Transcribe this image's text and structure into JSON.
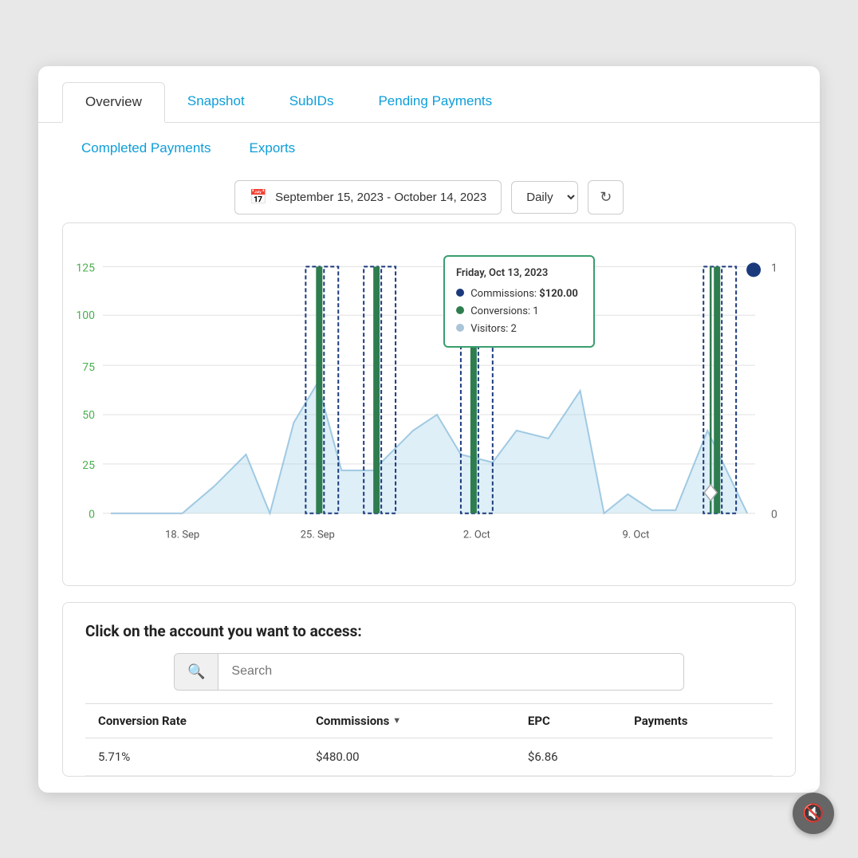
{
  "tabs_row1": [
    {
      "id": "overview",
      "label": "Overview",
      "active": true
    },
    {
      "id": "snapshot",
      "label": "Snapshot",
      "active": false
    },
    {
      "id": "subids",
      "label": "SubIDs",
      "active": false
    },
    {
      "id": "pending",
      "label": "Pending Payments",
      "active": false
    }
  ],
  "tabs_row2": [
    {
      "id": "completed",
      "label": "Completed Payments"
    },
    {
      "id": "exports",
      "label": "Exports"
    }
  ],
  "date_range": {
    "label": "September 15, 2023 - October 14, 2023",
    "interval": "Daily",
    "refresh_label": "↻"
  },
  "chart": {
    "y_labels": [
      "125",
      "100",
      "75",
      "50",
      "25",
      "0"
    ],
    "x_labels": [
      "18. Sep",
      "25. Sep",
      "2. Oct",
      "9. Oct"
    ],
    "right_labels": [
      "1",
      "0"
    ],
    "tooltip": {
      "title": "Friday, Oct 13, 2023",
      "commissions_label": "Commissions: ",
      "commissions_value": "$120.00",
      "conversions_label": "Conversions: 1",
      "visitors_label": "Visitors: 2"
    }
  },
  "section2": {
    "title": "Click on the account you want to access:",
    "search_placeholder": "Search",
    "table": {
      "headers": [
        {
          "id": "conversion_rate",
          "label": "Conversion Rate",
          "sortable": false
        },
        {
          "id": "commissions",
          "label": "Commissions",
          "sortable": true
        },
        {
          "id": "epc",
          "label": "EPC",
          "sortable": false
        },
        {
          "id": "payments",
          "label": "Payments",
          "sortable": false
        }
      ],
      "rows": [
        {
          "conversion_rate": "5.71%",
          "commissions": "$480.00",
          "epc": "$6.86",
          "payments": ""
        }
      ]
    }
  },
  "mute_icon": "🔇"
}
